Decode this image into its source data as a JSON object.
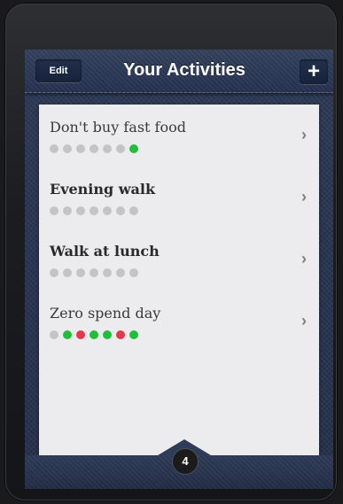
{
  "navbar": {
    "edit_label": "Edit",
    "title": "Your Activities",
    "add_label": "+"
  },
  "activities": [
    {
      "label": "Don't buy fast food",
      "bold": false,
      "progress": [
        "gray",
        "gray",
        "gray",
        "gray",
        "gray",
        "gray",
        "green"
      ]
    },
    {
      "label": "Evening walk",
      "bold": true,
      "progress": [
        "gray",
        "gray",
        "gray",
        "gray",
        "gray",
        "gray",
        "gray"
      ]
    },
    {
      "label": "Walk at lunch",
      "bold": true,
      "progress": [
        "gray",
        "gray",
        "gray",
        "gray",
        "gray",
        "gray",
        "gray"
      ]
    },
    {
      "label": "Zero spend day",
      "bold": false,
      "progress": [
        "gray",
        "green",
        "red",
        "green",
        "green",
        "red",
        "green"
      ]
    }
  ],
  "chevron": "›",
  "tabbar": {
    "count": "4"
  },
  "colors": {
    "green": "#1fbf3a",
    "red": "#e23a4a",
    "gray": "#c4c4c4"
  }
}
